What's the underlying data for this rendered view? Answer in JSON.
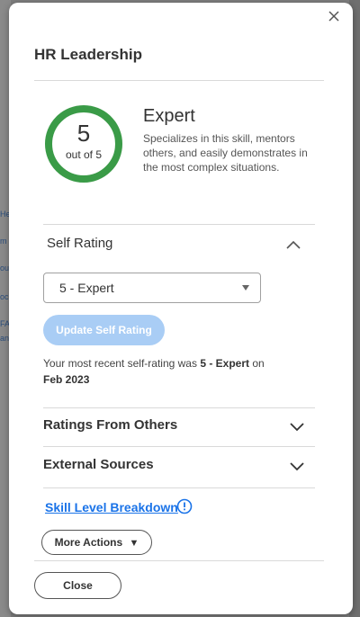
{
  "background": {
    "fragments": [
      "He",
      "m",
      "ou",
      "oc",
      "FA",
      "an"
    ]
  },
  "modal": {
    "title": "HR Leadership",
    "score": {
      "value": "5",
      "label": "out of 5",
      "fraction": 1.0,
      "ring_color": "#3a9b47"
    },
    "level": {
      "name": "Expert",
      "description": "Specializes in this skill, mentors others, and easily demonstrates in the most complex situations."
    },
    "self_rating": {
      "title": "Self Rating",
      "selected": "5 - Expert",
      "update_label": "Update Self Rating",
      "recent_prefix": "Your most recent self-rating was ",
      "recent_value": "5 - Expert",
      "recent_on": " on",
      "recent_date": "Feb 2023"
    },
    "sections": {
      "ratings_from_others": "Ratings From Others",
      "external_sources": "External Sources"
    },
    "skill_link": "Skill Level Breakdown",
    "more_actions": "More Actions",
    "more_actions_icon": "▼",
    "close_label": "Close"
  },
  "colors": {
    "accent": "#1a73e8",
    "ring": "#3a9b47",
    "disabled_button": "#a9cdf5"
  }
}
